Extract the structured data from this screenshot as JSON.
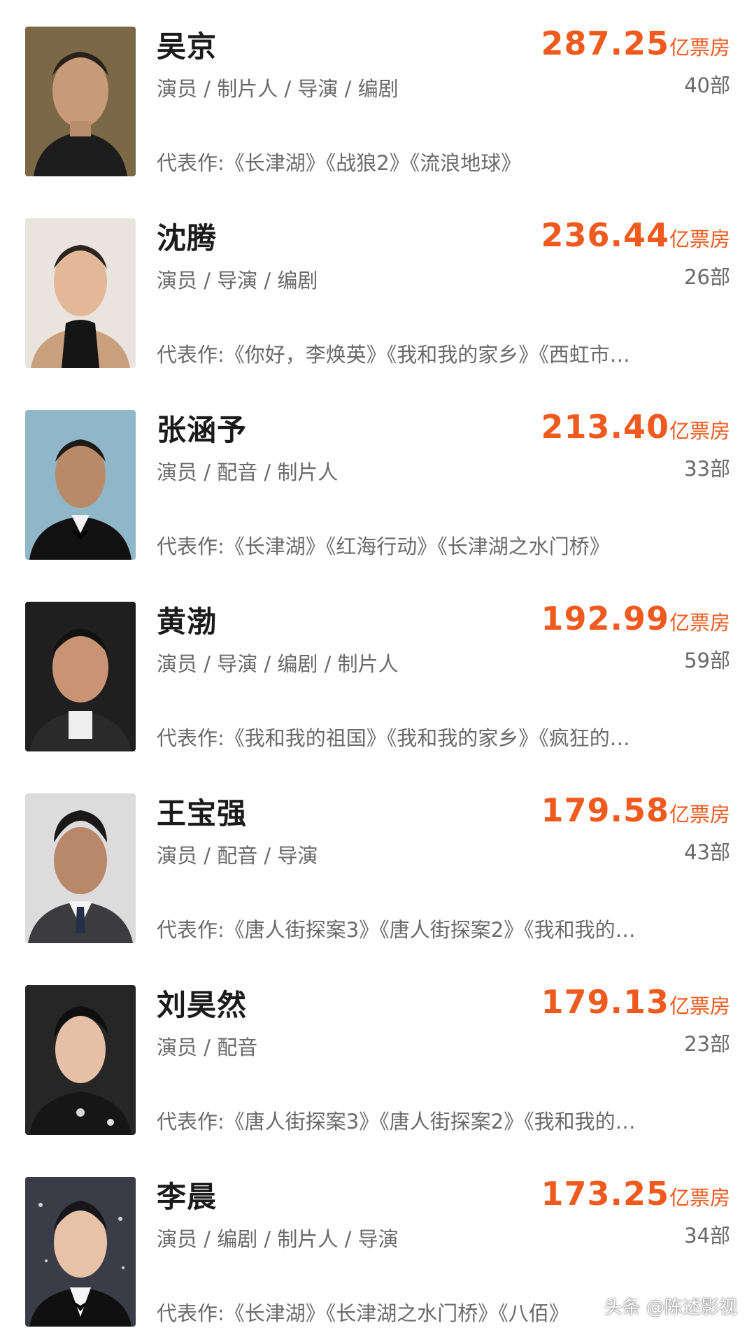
{
  "actors": [
    {
      "name": "吴京",
      "roles": "演员 / 制片人 / 导演 / 编剧",
      "box_value": "287.25",
      "box_unit": "亿票房",
      "count": "40部",
      "works_label": "代表作:",
      "works": "《长津湖》《战狼2》《流浪地球》"
    },
    {
      "name": "沈腾",
      "roles": "演员 / 导演 / 编剧",
      "box_value": "236.44",
      "box_unit": "亿票房",
      "count": "26部",
      "works_label": "代表作:",
      "works": "《你好，李焕英》《我和我的家乡》《西虹市…"
    },
    {
      "name": "张涵予",
      "roles": "演员 / 配音 / 制片人",
      "box_value": "213.40",
      "box_unit": "亿票房",
      "count": "33部",
      "works_label": "代表作:",
      "works": "《长津湖》《红海行动》《长津湖之水门桥》"
    },
    {
      "name": "黄渤",
      "roles": "演员 / 导演 / 编剧 / 制片人",
      "box_value": "192.99",
      "box_unit": "亿票房",
      "count": "59部",
      "works_label": "代表作:",
      "works": "《我和我的祖国》《我和我的家乡》《疯狂的…"
    },
    {
      "name": "王宝强",
      "roles": "演员 / 配音 / 导演",
      "box_value": "179.58",
      "box_unit": "亿票房",
      "count": "43部",
      "works_label": "代表作:",
      "works": "《唐人街探案3》《唐人街探案2》《我和我的…"
    },
    {
      "name": "刘昊然",
      "roles": "演员 / 配音",
      "box_value": "179.13",
      "box_unit": "亿票房",
      "count": "23部",
      "works_label": "代表作:",
      "works": "《唐人街探案3》《唐人街探案2》《我和我的…"
    },
    {
      "name": "李晨",
      "roles": "演员 / 编剧 / 制片人 / 导演",
      "box_value": "173.25",
      "box_unit": "亿票房",
      "count": "34部",
      "works_label": "代表作:",
      "works": "《长津湖》《长津湖之水门桥》《八佰》"
    }
  ],
  "watermark": "头条 @陈述影视",
  "colors": {
    "accent": "#f05a1e",
    "muted": "#6a6a6a",
    "name": "#1b1b1b"
  }
}
